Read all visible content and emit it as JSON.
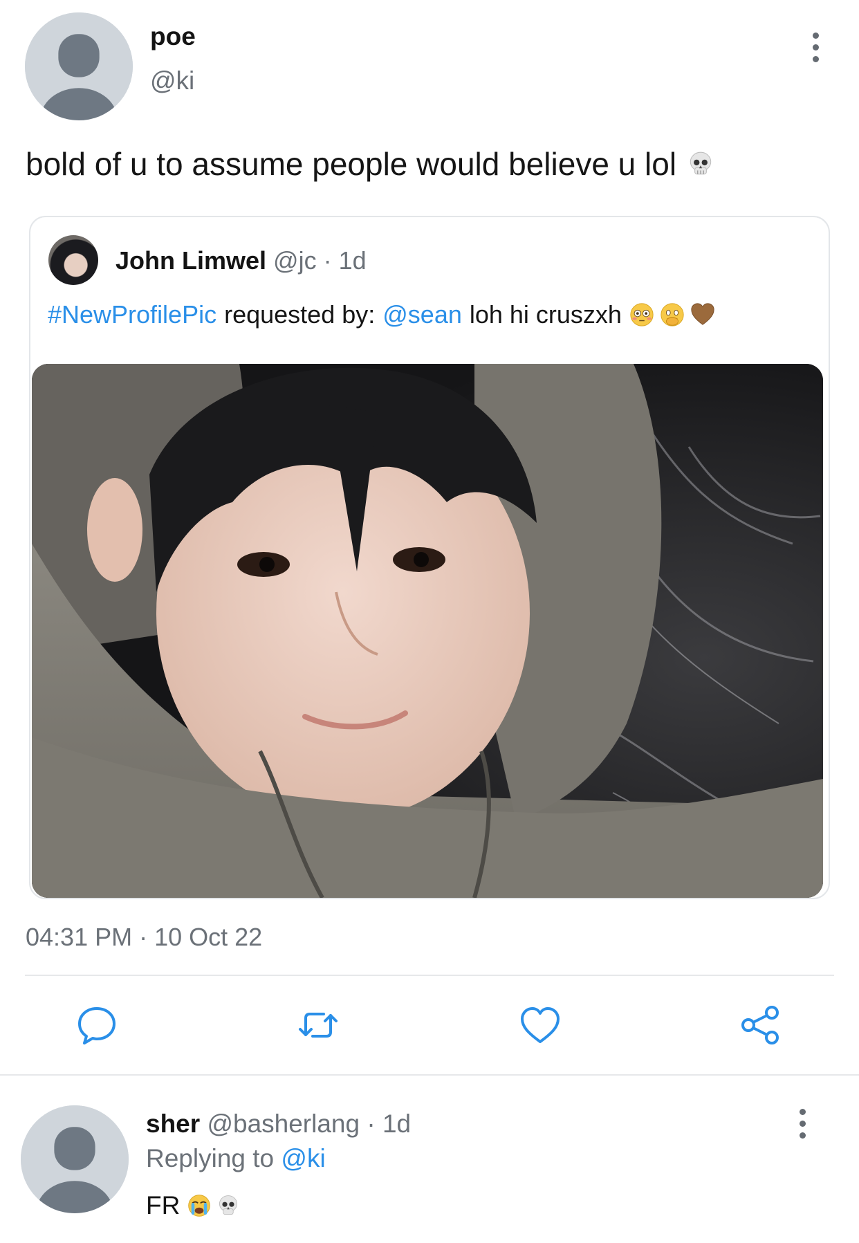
{
  "tweet": {
    "author_name": "poe",
    "author_handle": "@ki",
    "text": "bold of u to assume people would believe u lol",
    "text_emoji": "skull-emoji",
    "timestamp": "04:31 PM · 10 Oct 22"
  },
  "quote": {
    "author_name": "John Limwel",
    "author_handle": "@jc",
    "separator": "·",
    "age": "1d",
    "hashtag": "#NewProfilePic",
    "text_middle": "requested by:",
    "mention": "@sean",
    "text_end": "loh hi cruszxh",
    "emojis": [
      "flushed-face-emoji",
      "face-holding-back-tears-emoji",
      "brown-heart-emoji"
    ],
    "image": "profile-photo"
  },
  "actions": {
    "reply_icon": "speech-bubble-icon",
    "retweet_icon": "retweet-icon",
    "like_icon": "heart-icon",
    "share_icon": "share-icon"
  },
  "reply": {
    "author_name": "sher",
    "author_handle": "@basherlang",
    "separator": "·",
    "age": "1d",
    "replying_label": "Replying to",
    "replying_handle": "@ki",
    "text": "FR",
    "emojis": [
      "loudly-crying-face-emoji",
      "skull-emoji"
    ]
  },
  "colors": {
    "link": "#2a8fe8",
    "muted": "#6b7178",
    "divider": "#e6e8ea",
    "avatar_bg": "#cfd5db",
    "avatar_fg": "#6e7883"
  }
}
